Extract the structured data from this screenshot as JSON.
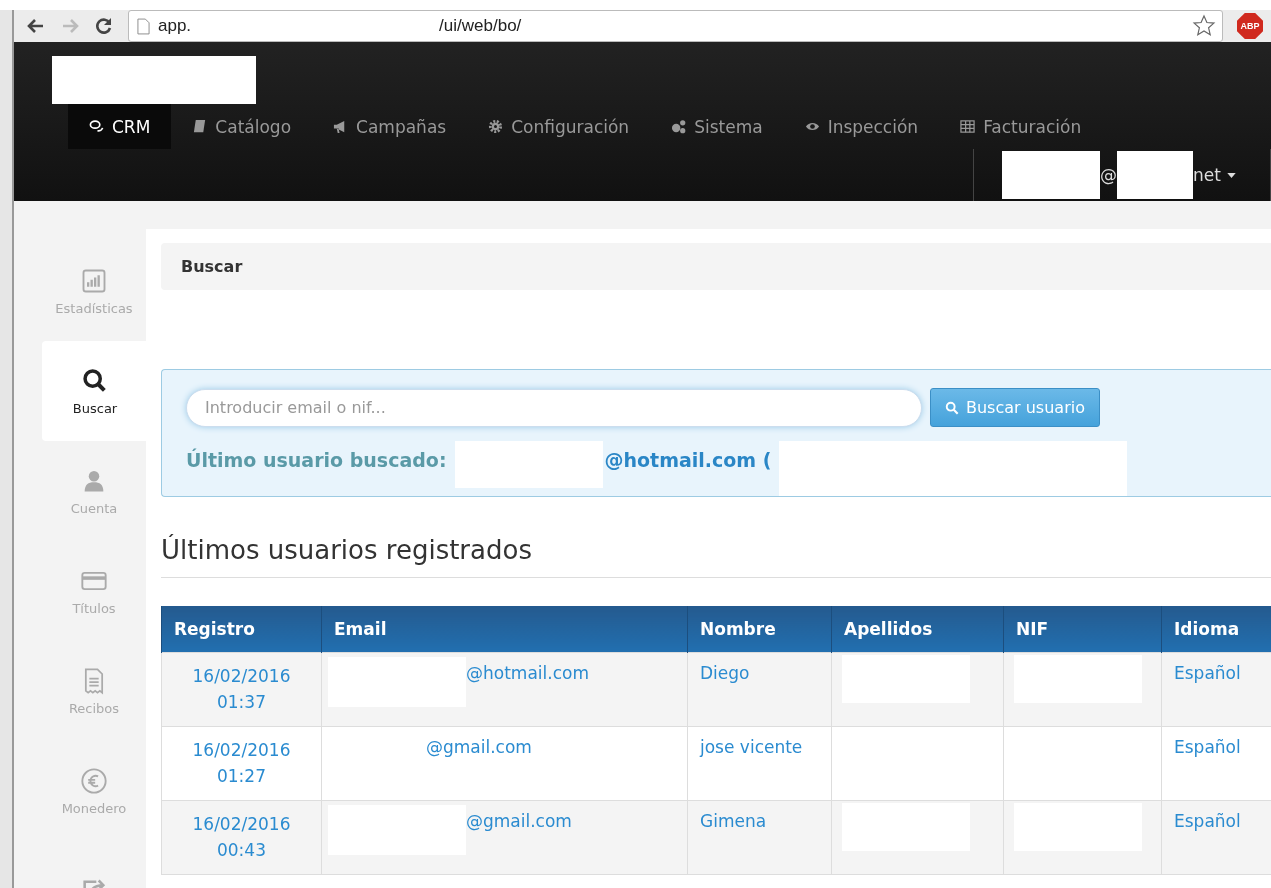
{
  "browser": {
    "url_start": "app.",
    "url_end": "/ui/web/bo/",
    "extension_badge": "ABP"
  },
  "navbar": {
    "items": [
      {
        "label": "CRM",
        "selected": true
      },
      {
        "label": "Catálogo",
        "selected": false
      },
      {
        "label": "Campañas",
        "selected": false
      },
      {
        "label": "Configuración",
        "selected": false
      },
      {
        "label": "Sistema",
        "selected": false
      },
      {
        "label": "Inspección",
        "selected": false
      },
      {
        "label": "Facturación",
        "selected": false
      }
    ],
    "user": {
      "at": "@",
      "domain_end": "net"
    }
  },
  "sidebar": {
    "items": [
      {
        "label": "Estadísticas",
        "selected": false
      },
      {
        "label": "Buscar",
        "selected": true
      },
      {
        "label": "Cuenta",
        "selected": false
      },
      {
        "label": "Títulos",
        "selected": false
      },
      {
        "label": "Recibos",
        "selected": false
      },
      {
        "label": "Monedero",
        "selected": false
      },
      {
        "selected": false
      }
    ]
  },
  "breadcrumb": "Buscar",
  "search": {
    "placeholder": "Introducir email o nif...",
    "button": "Buscar usuario",
    "last_label": "Último usuario buscado:",
    "last_value": "@hotmail.com ("
  },
  "section_title": "Últimos usuarios registrados",
  "table": {
    "columns": [
      "Registro",
      "Email",
      "Nombre",
      "Apellidos",
      "NIF",
      "Idioma"
    ],
    "rows": [
      {
        "date": "16/02/2016",
        "time": "01:37",
        "email": "@hotmail.com",
        "email_redacted": true,
        "nombre": "Diego",
        "apellidos_redacted": true,
        "nif_redacted": true,
        "idioma": "Español"
      },
      {
        "date": "16/02/2016",
        "time": "01:27",
        "email": "@gmail.com",
        "email_redacted": false,
        "nombre": "jose vicente",
        "apellidos_redacted": false,
        "nif_redacted": false,
        "idioma": "Español"
      },
      {
        "date": "16/02/2016",
        "time": "00:43",
        "email": "@gmail.com",
        "email_redacted": true,
        "nombre": "Gimena",
        "apellidos_redacted": true,
        "nif_redacted": true,
        "idioma": "Español"
      }
    ]
  }
}
